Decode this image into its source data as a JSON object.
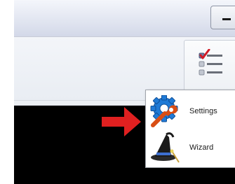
{
  "window": {
    "buttons": {
      "minimize_icon": "minimize-icon"
    }
  },
  "toolbar": {
    "tasks_button_icon": "checklist-icon"
  },
  "popup_menu": {
    "items": [
      {
        "label": "Settings",
        "icon": "settings-wrench-gear-icon"
      },
      {
        "label": "Wizard",
        "icon": "wizard-hat-icon"
      }
    ]
  },
  "annotation": {
    "icon": "red-arrow-icon",
    "color": "#e02020"
  },
  "colors": {
    "content_background": "#000000",
    "accent_blue": "#1f7ad6",
    "wrench_orange": "#d94e14"
  }
}
